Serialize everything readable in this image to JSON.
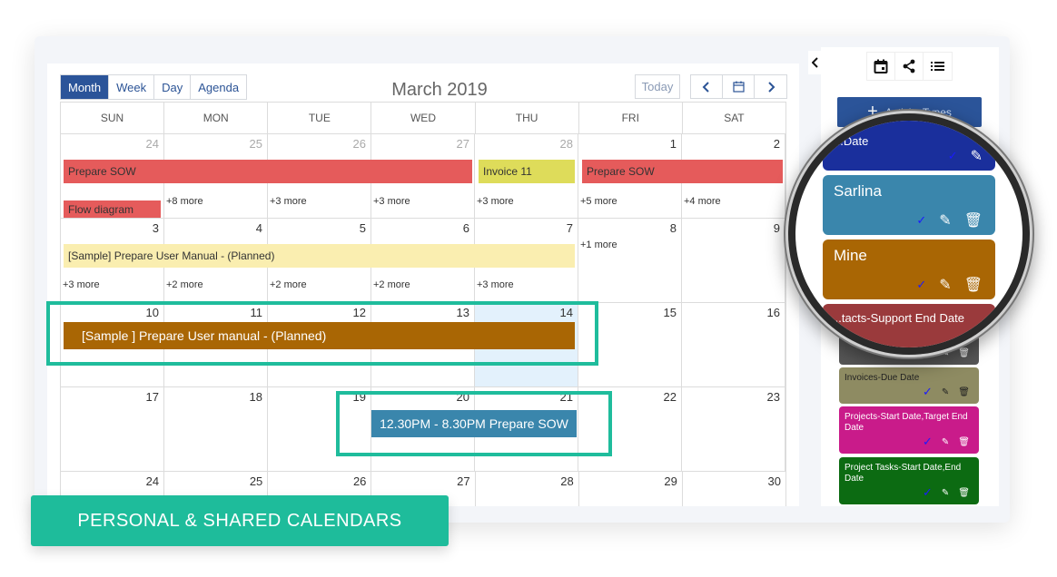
{
  "calendar": {
    "title": "March 2019",
    "views": [
      {
        "label": "Month",
        "active": true
      },
      {
        "label": "Week",
        "active": false
      },
      {
        "label": "Day",
        "active": false
      },
      {
        "label": "Agenda",
        "active": false
      }
    ],
    "today_label": "Today",
    "nav": {
      "prev_icon": "chevron-left-icon",
      "calendar_icon": "calendar-icon",
      "next_icon": "chevron-right-icon"
    },
    "weekdays": [
      "SUN",
      "MON",
      "TUE",
      "WED",
      "THU",
      "FRI",
      "SAT"
    ],
    "weeks": [
      {
        "days": [
          "24",
          "25",
          "26",
          "27",
          "28",
          "1",
          "2"
        ],
        "other_month": [
          true,
          true,
          true,
          true,
          true,
          false,
          false
        ],
        "more": [
          "",
          "+8 more",
          "+3 more",
          "+3 more",
          "+3 more",
          "+5 more",
          "+4 more"
        ],
        "events": [
          {
            "title": "Prepare SOW",
            "color": "#e55b5b"
          },
          {
            "title": "Invoice 11",
            "color": "#dedc5a"
          },
          {
            "title": "Prepare SOW",
            "color": "#e55b5b"
          },
          {
            "title": "Flow diagram",
            "color": "#e55b5b"
          }
        ]
      },
      {
        "days": [
          "3",
          "4",
          "5",
          "6",
          "7",
          "8",
          "9"
        ],
        "more": [
          "+3 more",
          "+2 more",
          "+2 more",
          "+2 more",
          "+3 more",
          "+1 more",
          ""
        ],
        "events": [
          {
            "title": "[Sample] Prepare User Manual - (Planned)",
            "color": "#faeeb0"
          }
        ]
      },
      {
        "days": [
          "10",
          "11",
          "12",
          "13",
          "14",
          "15",
          "16"
        ],
        "today_index": 4,
        "events": [
          {
            "title": "[Sample ] Prepare User manual - (Planned)",
            "color": "#a96604"
          }
        ]
      },
      {
        "days": [
          "17",
          "18",
          "19",
          "20",
          "21",
          "22",
          "23"
        ],
        "events": [
          {
            "title": "12.30PM - 8.30PM Prepare SOW",
            "color": "#3a86ac"
          }
        ]
      },
      {
        "days": [
          "24",
          "25",
          "26",
          "27",
          "28",
          "29",
          "30"
        ]
      }
    ]
  },
  "sidebar": {
    "collapse_icon": "chevron-left-icon",
    "toolbar_icons": [
      "calendar-icon",
      "share-icon",
      "list-icon"
    ],
    "activity_types_label": "Activity Types",
    "cards": [
      {
        "label": "...Date",
        "color": "#1a2f9c"
      },
      {
        "label": "Sarlina",
        "color": "#3a86ac"
      },
      {
        "label": "Mine",
        "color": "#a96604"
      },
      {
        "label": "...tacts-Support End Date",
        "color": "#9a3a3c"
      },
      {
        "label": "Co...",
        "color": "#555555"
      },
      {
        "label": "Invoices-Due Date",
        "color": "#8e8b62"
      },
      {
        "label": "Projects-Start Date,Target End Date",
        "color": "#c91b8a"
      },
      {
        "label": "Project Tasks-Start Date,End Date",
        "color": "#0c6b12"
      }
    ]
  },
  "banner": {
    "text": "PERSONAL & SHARED CALENDARS"
  }
}
